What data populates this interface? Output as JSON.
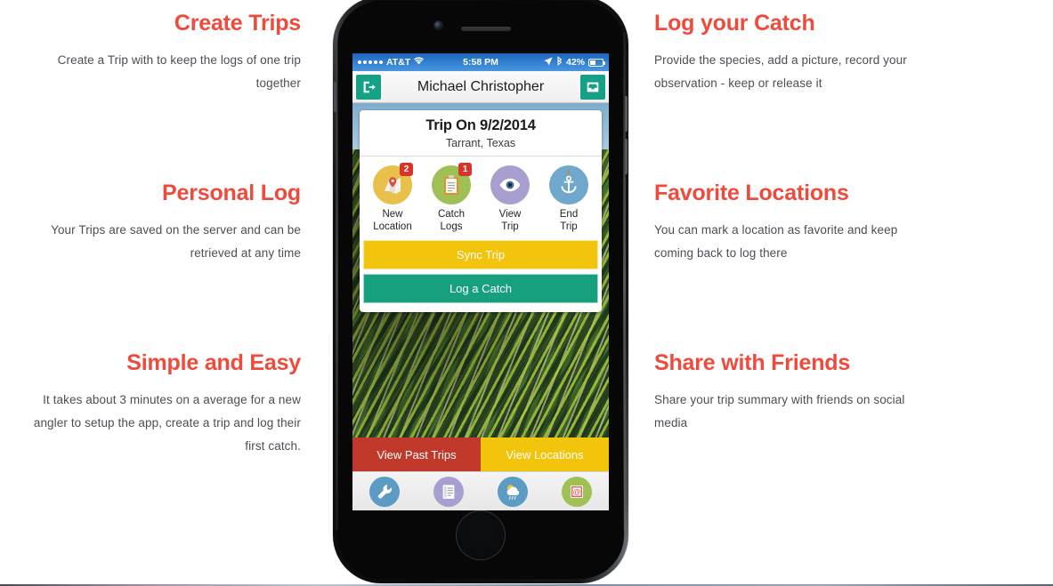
{
  "theme": {
    "heading_color": "#ef4a3c",
    "body_color": "#4a4f55",
    "accent_teal": "#16a085",
    "accent_yellow": "#f2c40c",
    "accent_red": "#c0392b",
    "badge_red": "#d9342b"
  },
  "features": {
    "left": [
      {
        "title": "Create Trips",
        "body": "Create a Trip with to keep the logs of one trip together"
      },
      {
        "title": "Personal Log",
        "body": "Your Trips are saved on the server and can be retrieved at any time"
      },
      {
        "title": "Simple and Easy",
        "body": "It takes about 3 minutes on a average for a new angler to setup the app, create a trip and log their first catch."
      }
    ],
    "right": [
      {
        "title": "Log your Catch",
        "body": "Provide the species, add a picture, record your observation - keep or release it"
      },
      {
        "title": "Favorite Locations",
        "body": "You can mark a location as favorite and keep coming back to log there"
      },
      {
        "title": "Share with Friends",
        "body": "Share your trip summary with friends on social media"
      }
    ]
  },
  "phone": {
    "status_bar": {
      "carrier": "AT&T",
      "signal_icon": "signal-dots-icon",
      "wifi_icon": "wifi-icon",
      "time": "5:58 PM",
      "location_icon": "location-arrow-icon",
      "bluetooth_icon": "bluetooth-icon",
      "battery_percent": "42%",
      "battery_icon": "battery-icon"
    },
    "nav_bar": {
      "left_icon": "logout-icon",
      "title": "Michael Christopher",
      "right_icon": "inbox-tray-icon"
    },
    "trip_card": {
      "title": "Trip On 9/2/2014",
      "subtitle": "Tarrant, Texas",
      "actions": [
        {
          "label_line1": "New",
          "label_line2": "Location",
          "icon": "map-pin-icon",
          "badge": "2",
          "circle_color": "#e8c04a"
        },
        {
          "label_line1": "Catch",
          "label_line2": "Logs",
          "icon": "clipboard-icon",
          "badge": "1",
          "circle_color": "#9fc054"
        },
        {
          "label_line1": "View",
          "label_line2": "Trip",
          "icon": "eye-icon",
          "badge": "",
          "circle_color": "#a99ed0"
        },
        {
          "label_line1": "End",
          "label_line2": "Trip",
          "icon": "anchor-icon",
          "badge": "",
          "circle_color": "#6fa8cc"
        }
      ],
      "buttons": [
        {
          "label": "Sync Trip",
          "color": "#f2c40c"
        },
        {
          "label": "Log a Catch",
          "color": "#17a07e"
        }
      ]
    },
    "footer_split": [
      {
        "label": "View Past Trips",
        "color": "#c0392b"
      },
      {
        "label": "View Locations",
        "color": "#f2c40c"
      }
    ],
    "tab_bar": [
      {
        "icon": "wrench-icon",
        "circle_color": "#5b9bc4"
      },
      {
        "icon": "document-icon",
        "circle_color": "#a99ed0"
      },
      {
        "icon": "weather-icon",
        "circle_color": "#5b9bc4"
      },
      {
        "icon": "email-stamp-icon",
        "circle_color": "#9fc054"
      }
    ],
    "hardware": {
      "camera": "front-camera",
      "speaker": "earpiece-speaker",
      "home_button": "home-button"
    }
  }
}
